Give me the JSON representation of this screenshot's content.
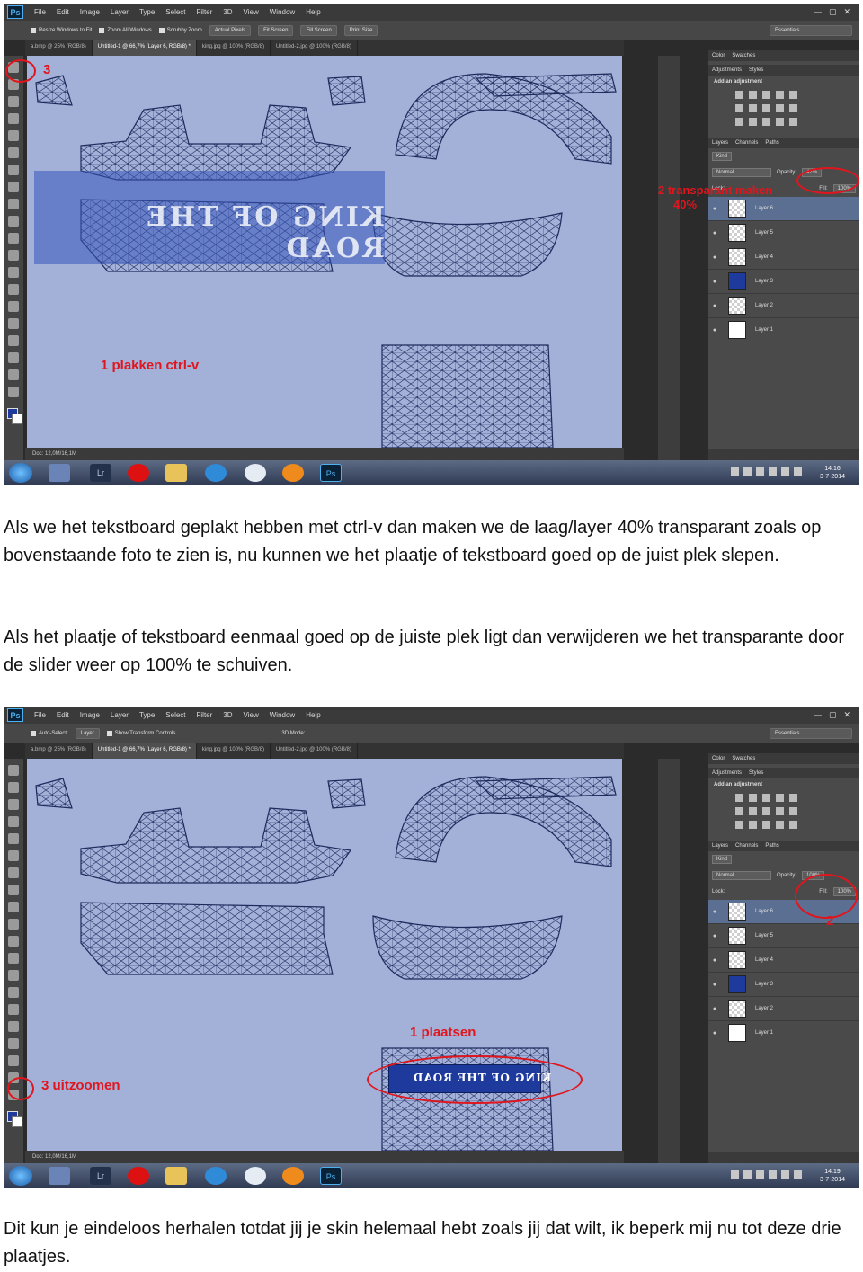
{
  "screenshot1": {
    "menu": [
      "File",
      "Edit",
      "Image",
      "Layer",
      "Type",
      "Select",
      "Filter",
      "3D",
      "View",
      "Window",
      "Help"
    ],
    "options": {
      "buttons": [
        "Resize Windows to Fit",
        "Zoom All Windows",
        "Scrubby Zoom",
        "Actual Pixels",
        "Fit Screen",
        "Fill Screen",
        "Print Size"
      ],
      "workspace": "Essentials"
    },
    "tabs": [
      "a.bmp @ 25% (RGB/8)",
      "Untitled-1 @ 66,7% (Layer 6, RGB/8) *",
      "king.jpg @ 100% (RGB/8)",
      "Untitled-2.jpg @ 100% (RGB/8)"
    ],
    "status": "Doc: 12,0M/16,1M",
    "panel": {
      "tabs": [
        "Color",
        "Swatches"
      ],
      "subtabs": [
        "Adjustments",
        "Styles"
      ],
      "adj_title": "Add an adjustment",
      "layer_tabs": [
        "Layers",
        "Channels",
        "Paths"
      ],
      "kind": "Kind",
      "blend": "Normal",
      "opacity_label": "Opacity:",
      "opacity": "42%",
      "lock_label": "Lock:",
      "fill_label": "Fill:",
      "fill": "100%",
      "layers": [
        "Layer 6",
        "Layer 5",
        "Layer 4",
        "Layer 3",
        "Layer 2",
        "Layer 1"
      ]
    },
    "annotations": {
      "step3": "3",
      "step1": "1 plakken ctrl-v",
      "step2a": "2 transparant maken",
      "step2b": "40%"
    },
    "clock_time": "14:16",
    "clock_date": "3-7-2014",
    "taskbar_labels": {
      "lightroom": "Lr",
      "photoshop": "Ps"
    }
  },
  "paragraph1": "Als we het tekstboard geplakt hebben met ctrl-v dan maken we de laag/layer   40% transparant zoals op bovenstaande foto te zien is, nu kunnen we het plaatje of tekstboard goed op de juist plek slepen.",
  "paragraph2": "Als het plaatje of tekstboard eenmaal goed op de juiste plek ligt dan verwijderen we het transparante door de slider weer op 100% te schuiven.",
  "screenshot2": {
    "menu": [
      "File",
      "Edit",
      "Image",
      "Layer",
      "Type",
      "Select",
      "Filter",
      "3D",
      "View",
      "Window",
      "Help"
    ],
    "options": {
      "autoselect": "Auto-Select:",
      "autoselect_value": "Layer",
      "transform": "Show Transform Controls",
      "mode3d": "3D Mode:",
      "workspace": "Essentials"
    },
    "tabs": [
      "a.bmp @ 25% (RGB/8)",
      "Untitled-1 @ 66,7% (Layer 6, RGB/8) *",
      "king.jpg @ 100% (RGB/8)",
      "Untitled-2.jpg @ 100% (RGB/8)"
    ],
    "status": "Doc: 12,0M/16,1M",
    "panel": {
      "tabs": [
        "Color",
        "Swatches"
      ],
      "subtabs": [
        "Adjustments",
        "Styles"
      ],
      "adj_title": "Add an adjustment",
      "layer_tabs": [
        "Layers",
        "Channels",
        "Paths"
      ],
      "kind": "Kind",
      "blend": "Normal",
      "opacity_label": "Opacity:",
      "opacity": "100%",
      "lock_label": "Lock:",
      "fill_label": "Fill:",
      "fill": "100%",
      "layers": [
        "Layer 6",
        "Layer 5",
        "Layer 4",
        "Layer 3",
        "Layer 2",
        "Layer 1"
      ]
    },
    "annotations": {
      "step1": "1 plaatsen",
      "step2": "2",
      "step3": "3 uitzoomen"
    },
    "clock_time": "14:19",
    "clock_date": "3-7-2014",
    "taskbar_labels": {
      "lightroom": "Lr",
      "photoshop": "Ps"
    }
  },
  "paragraph3": "Dit kun je eindeloos herhalen totdat jij je skin helemaal hebt zoals jij dat wilt, ik beperk mij nu tot deze drie plaatjes.",
  "colors": {
    "canvas": "#a3b1d9",
    "wireframe": "#1f2a5c",
    "annotation": "#e0151d",
    "banner": "#1e3a9c",
    "ps_dark": "#2b2b2b"
  }
}
